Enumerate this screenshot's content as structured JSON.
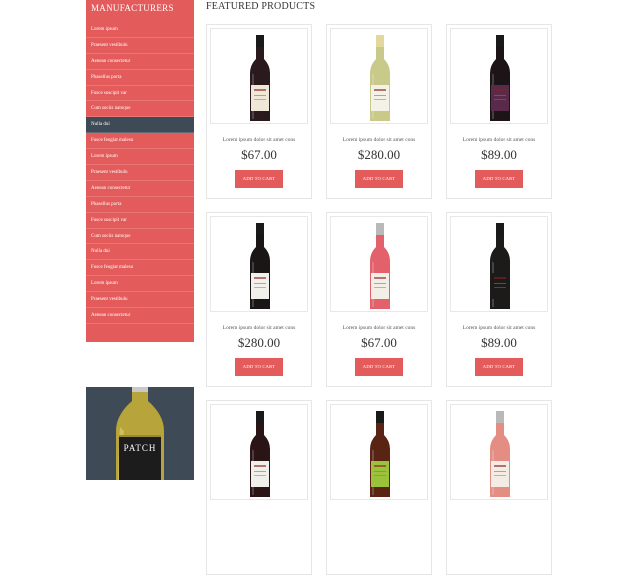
{
  "sidebar": {
    "title": "MANUFACTURERS",
    "items": [
      {
        "label": "Lorem ipsum"
      },
      {
        "label": "Praesent vestibulu"
      },
      {
        "label": "Aenean consectetur"
      },
      {
        "label": "Phasellus porta"
      },
      {
        "label": "Fusce suscipit var"
      },
      {
        "label": "Cum sociis natoque"
      },
      {
        "label": "Nulla dui",
        "active": true
      },
      {
        "label": "Fusce feugiat malesu"
      },
      {
        "label": "Lorem ipsum"
      },
      {
        "label": "Praesent vestibulu"
      },
      {
        "label": "Aenean consectetur"
      },
      {
        "label": "Phasellus porta"
      },
      {
        "label": "Fusce suscipit var"
      },
      {
        "label": "Cum sociis natoque"
      },
      {
        "label": "Nulla dui"
      },
      {
        "label": "Fusce feugiat malesu"
      },
      {
        "label": "Lorem ipsum"
      },
      {
        "label": "Praesent vestibulu"
      },
      {
        "label": "Aenean consectetur"
      }
    ]
  },
  "banner": {
    "label": "PATCH",
    "colors": {
      "bottle": "#b7a43a",
      "background": "#3e4a55"
    }
  },
  "main": {
    "heading": "FEATURED PRODUCTS",
    "products": [
      {
        "description": "Lorem ipsum dolor sit amet cons",
        "price": "$67.00",
        "cart_label": "ADD TO CART",
        "wine": "red",
        "label_color": "#efe7d8",
        "bottle_color": "#2b1a1d"
      },
      {
        "description": "Lorem ipsum dolor sit amet cons",
        "price": "$280.00",
        "cart_label": "ADD TO CART",
        "wine": "white",
        "label_color": "#f4f1e6",
        "bottle_color": "#c9c98a"
      },
      {
        "description": "Lorem ipsum dolor sit amet cons",
        "price": "$89.00",
        "cart_label": "ADD TO CART",
        "wine": "red",
        "label_color": "#5a2a4a",
        "bottle_color": "#1c1416"
      },
      {
        "description": "Lorem ipsum dolor sit amet cons",
        "price": "$280.00",
        "cart_label": "ADD TO CART",
        "wine": "red",
        "label_color": "#f2f0ea",
        "bottle_color": "#1a1616"
      },
      {
        "description": "Lorem ipsum dolor sit amet cons",
        "price": "$67.00",
        "cart_label": "ADD TO CART",
        "wine": "rose",
        "label_color": "#f3efe6",
        "bottle_color": "#e2616b"
      },
      {
        "description": "Lorem ipsum dolor sit amet cons",
        "price": "$89.00",
        "cart_label": "ADD TO CART",
        "wine": "red",
        "label_color": "#1d1a1a",
        "bottle_color": "#1d1a1a"
      },
      {
        "wine": "red",
        "label_color": "#f1efe9",
        "bottle_color": "#2a1416"
      },
      {
        "wine": "red",
        "label_color": "#9bc23b",
        "bottle_color": "#5a2414"
      },
      {
        "wine": "rose",
        "label_color": "#f2ece4",
        "bottle_color": "#e48d83"
      }
    ]
  }
}
